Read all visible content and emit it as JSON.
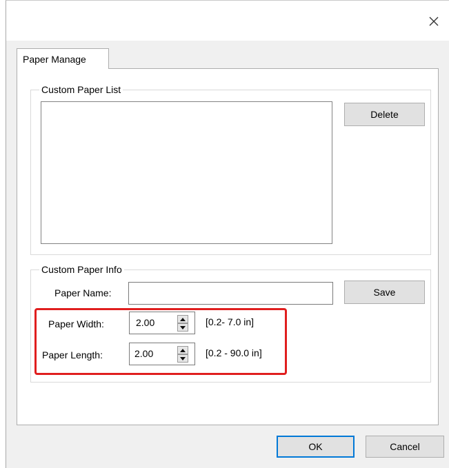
{
  "window": {
    "close_glyph": "✕"
  },
  "tabs": [
    {
      "label": "Paper Manage",
      "selected": true
    }
  ],
  "custom_paper_list": {
    "group_label": "Custom Paper List",
    "items": [],
    "delete_label": "Delete"
  },
  "custom_paper_info": {
    "group_label": "Custom Paper Info",
    "paper_name_label": "Paper Name:",
    "paper_name_value": "",
    "save_label": "Save",
    "paper_width_label": "Paper Width:",
    "paper_width_value": "2.00",
    "paper_width_range": "[0.2- 7.0 in]",
    "paper_length_label": "Paper Length:",
    "paper_length_value": "2.00",
    "paper_length_range": "[0.2 - 90.0 in]"
  },
  "footer": {
    "ok_label": "OK",
    "cancel_label": "Cancel"
  },
  "colors": {
    "highlight": "#e01e1e",
    "default_button_border": "#0078d7",
    "dialog_background": "#f0f0f0"
  },
  "icons": [
    "close-icon",
    "spin-up-icon",
    "spin-down-icon"
  ]
}
